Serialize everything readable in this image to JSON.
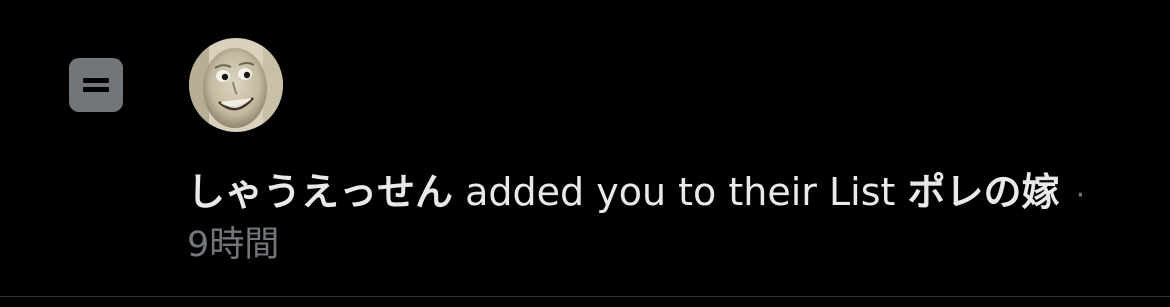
{
  "notification": {
    "icon": "list-icon",
    "avatar": "user-avatar",
    "actor_name": "しゃうえっせん",
    "action_text": "added you to their List",
    "list_name": "ポレの嫁",
    "separator": "·",
    "timestamp": "9時間"
  },
  "colors": {
    "background": "#000000",
    "primary_text": "#e7e9ea",
    "secondary_text": "#71767b",
    "icon_badge": "#71767b",
    "divider": "#2f3336"
  }
}
